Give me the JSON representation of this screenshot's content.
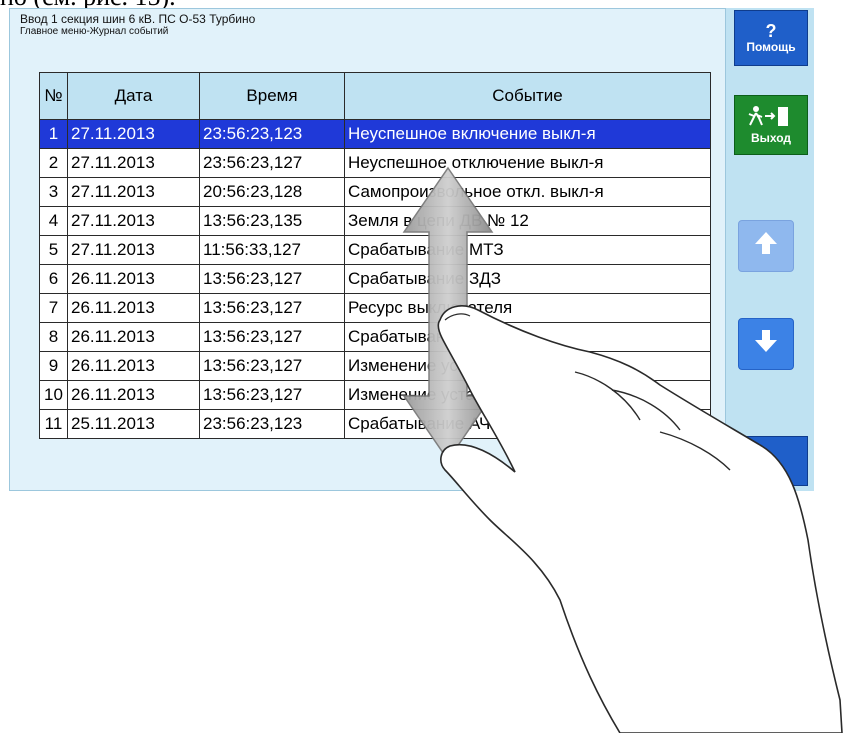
{
  "document_text": "но (см. рис. 15).",
  "header": {
    "title": "Ввод 1 секция шин 6 кВ. ПС О-53 Турбино",
    "breadcrumb": "Главное меню-Журнал событий"
  },
  "sidebar": {
    "help_icon": "?",
    "help_label": "Помощь",
    "exit_icon": "exit-person-icon",
    "exit_label": "Выход",
    "up_icon": "arrow-up-icon",
    "down_icon": "arrow-down-icon",
    "bottom_icon": "partial-icon"
  },
  "table": {
    "columns": [
      "№",
      "Дата",
      "Время",
      "Событие"
    ],
    "rows": [
      {
        "n": "1",
        "date": "27.11.2013",
        "time": "23:56:23,123",
        "event": "Неуспешное включение выкл-я"
      },
      {
        "n": "2",
        "date": "27.11.2013",
        "time": "23:56:23,127",
        "event": "Неуспешное отключение выкл-я"
      },
      {
        "n": "3",
        "date": "27.11.2013",
        "time": "20:56:23,128",
        "event": "Самопроизвольное откл. выкл-я"
      },
      {
        "n": "4",
        "date": "27.11.2013",
        "time": "13:56:23,135",
        "event": "Земля в цепи ДВ № 12"
      },
      {
        "n": "5",
        "date": "27.11.2013",
        "time": "11:56:33,127",
        "event": "Срабатывание МТЗ"
      },
      {
        "n": "6",
        "date": "26.11.2013",
        "time": "13:56:23,127",
        "event": "Срабатывание ЗДЗ"
      },
      {
        "n": "7",
        "date": "26.11.2013",
        "time": "13:56:23,127",
        "event": "Ресурс выключателя"
      },
      {
        "n": "8",
        "date": "26.11.2013",
        "time": "13:56:23,127",
        "event": "Срабатывание ОВ"
      },
      {
        "n": "9",
        "date": "26.11.2013",
        "time": "13:56:23,127",
        "event": "Изменение уставок"
      },
      {
        "n": "10",
        "date": "26.11.2013",
        "time": "13:56:23,127",
        "event": "Изменение уставок"
      },
      {
        "n": "11",
        "date": "25.11.2013",
        "time": "23:56:23,123",
        "event": "Срабатывание АЧР"
      }
    ],
    "selected_index": 0
  },
  "colors": {
    "panel_bg": "#e1f2fa",
    "selected_row": "#1f39d8",
    "help_button": "#1f5fc9",
    "exit_button": "#1e8b2e",
    "arrow_up_disabled": "#8fb8ee",
    "arrow_down": "#3c82e6"
  }
}
